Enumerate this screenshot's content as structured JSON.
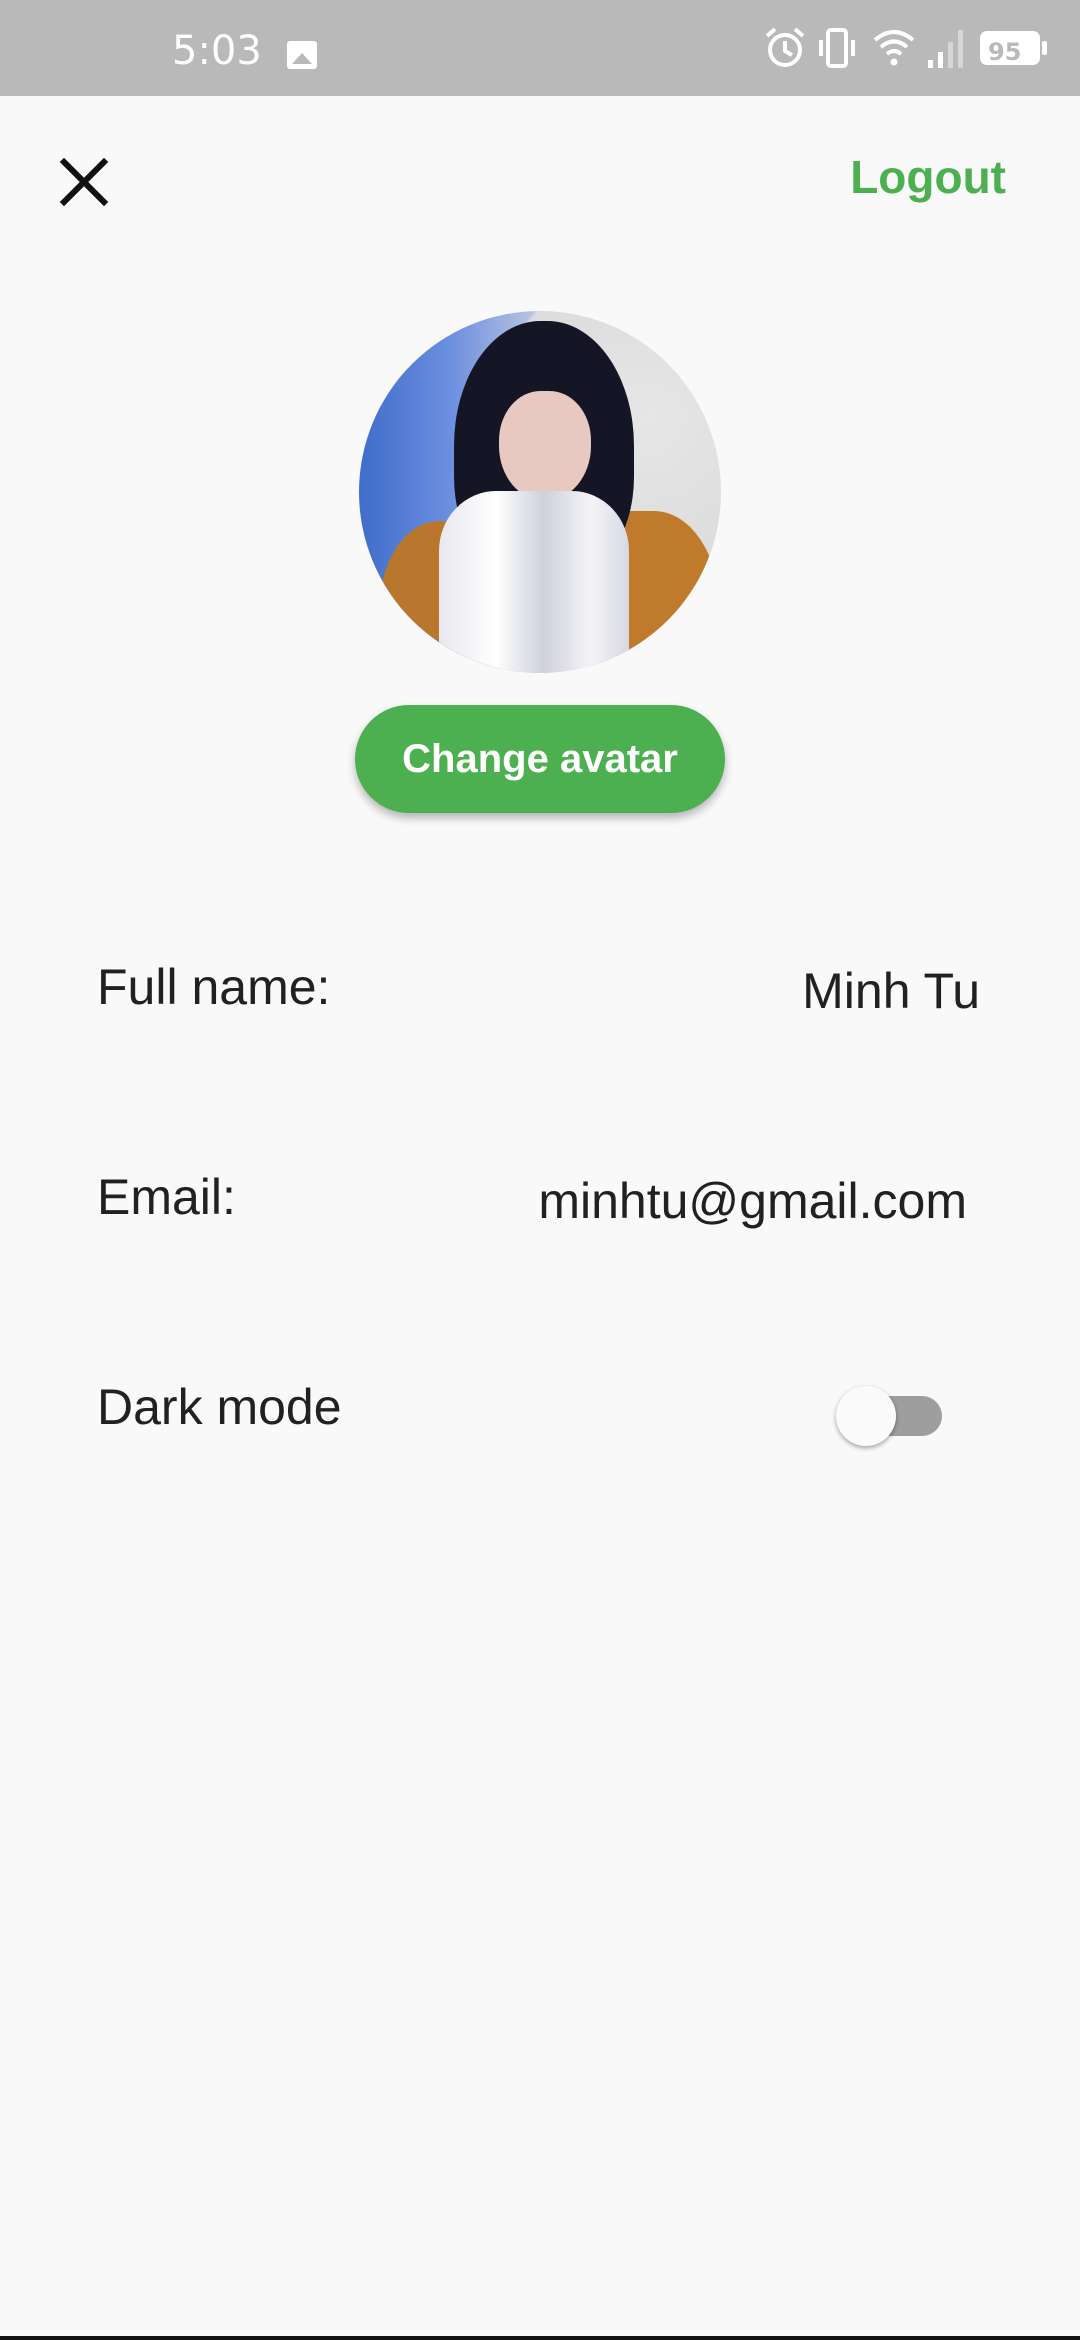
{
  "status_bar": {
    "time": "5:03",
    "battery": "95",
    "icons": [
      "image-icon",
      "alarm-icon",
      "vibrate-icon",
      "wifi-icon",
      "signal-icon",
      "battery-icon"
    ]
  },
  "header": {
    "close_icon": "close-icon",
    "logout_label": "Logout"
  },
  "profile": {
    "change_avatar_label": "Change avatar",
    "full_name_label": "Full name:",
    "full_name_value": "Minh Tu",
    "email_label": "Email:",
    "email_value": "minhtu@gmail.com",
    "dark_mode_label": "Dark mode",
    "dark_mode_on": false
  },
  "colors": {
    "accent": "#4caf50",
    "status_bar": "#b9b9b9",
    "background": "#f9f9f9"
  }
}
